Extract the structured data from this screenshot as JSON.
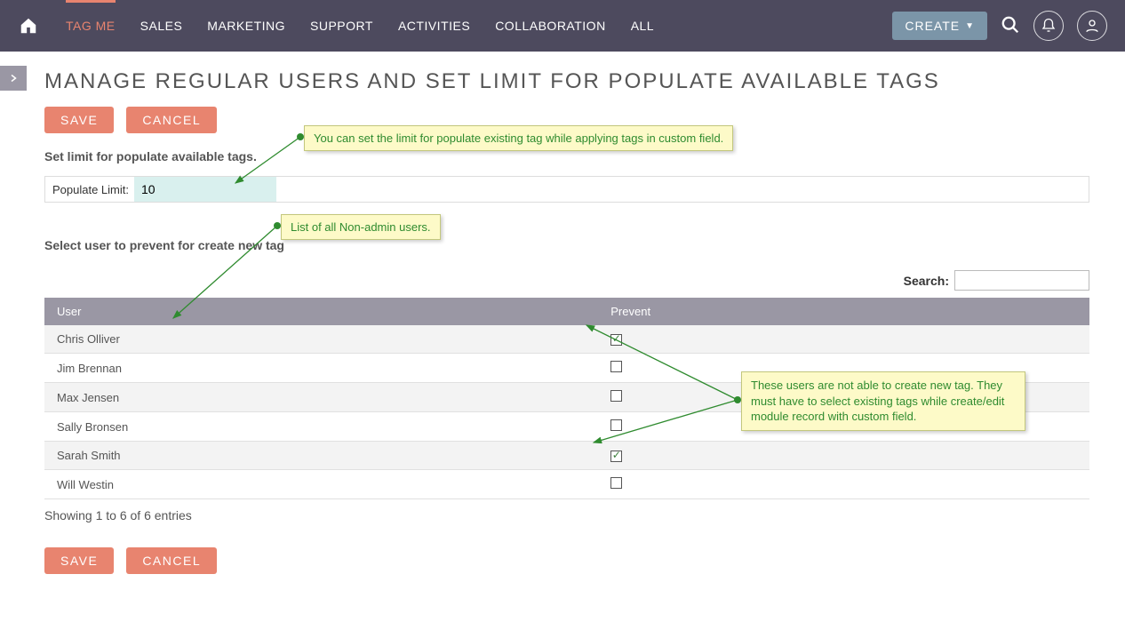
{
  "nav": {
    "tabs": [
      "TAG ME",
      "SALES",
      "MARKETING",
      "SUPPORT",
      "ACTIVITIES",
      "COLLABORATION",
      "ALL"
    ],
    "active_index": 0,
    "create_label": "CREATE"
  },
  "page": {
    "title": "MANAGE REGULAR USERS AND SET LIMIT FOR POPULATE AVAILABLE TAGS",
    "save_label": "SAVE",
    "cancel_label": "CANCEL",
    "limit_section_label": "Set limit for populate available tags.",
    "populate_limit_label": "Populate Limit:",
    "populate_limit_value": "10",
    "select_user_label": "Select user to prevent for create new tag",
    "search_label": "Search:",
    "search_value": "",
    "status_text": "Showing 1 to 6 of 6 entries"
  },
  "table": {
    "col_user": "User",
    "col_prevent": "Prevent",
    "rows": [
      {
        "user": "Chris Olliver",
        "prevent": true
      },
      {
        "user": "Jim Brennan",
        "prevent": false
      },
      {
        "user": "Max Jensen",
        "prevent": false
      },
      {
        "user": "Sally Bronsen",
        "prevent": false
      },
      {
        "user": "Sarah Smith",
        "prevent": true
      },
      {
        "user": "Will Westin",
        "prevent": false
      }
    ]
  },
  "callouts": {
    "c1": "You can set the limit for populate existing tag while applying tags in custom field.",
    "c2": "List of all Non-admin users.",
    "c3": "These users are not able to create new tag. They must have to select existing tags while create/edit module record with custom field."
  }
}
